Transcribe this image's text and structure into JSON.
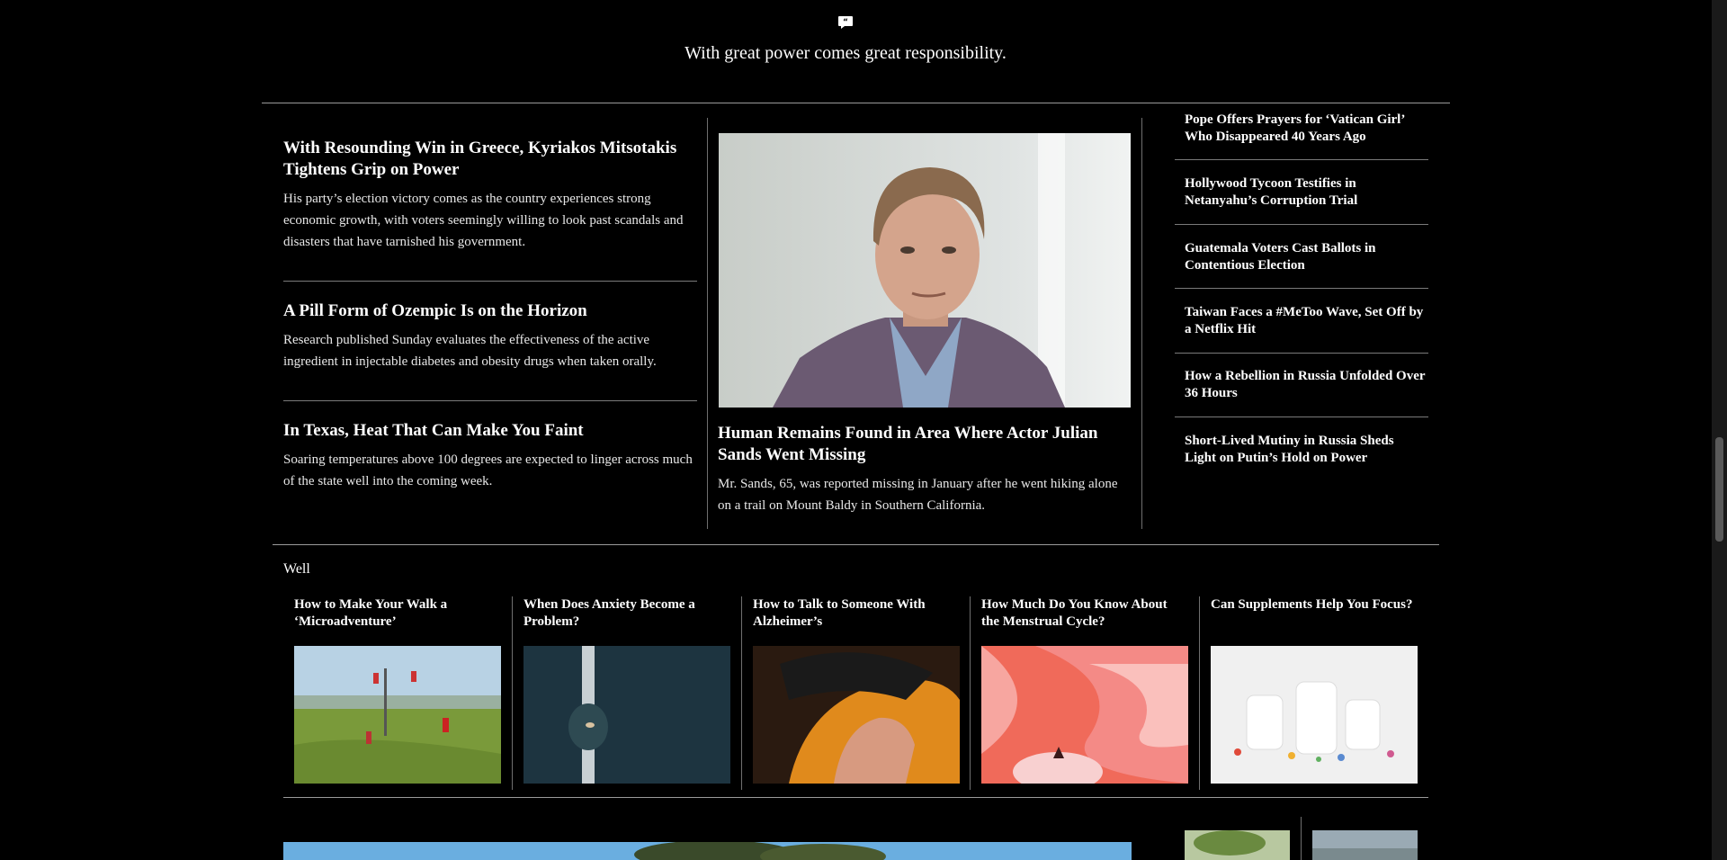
{
  "quote": {
    "icon": "quote-icon",
    "text": "With great power comes great responsibility."
  },
  "left_stories": [
    {
      "headline": "With Resounding Win in Greece, Kyriakos Mitsotakis Tightens Grip on Power",
      "summary": "His party’s election victory comes as the country experiences strong economic growth, with voters seemingly willing to look past scandals and disasters that have tarnished his government."
    },
    {
      "headline": "A Pill Form of Ozempic Is on the Horizon",
      "summary": "Research published Sunday evaluates the effectiveness of the active ingredient in injectable diabetes and obesity drugs when taken orally."
    },
    {
      "headline": "In Texas, Heat That Can Make You Faint",
      "summary": "Soaring temperatures above 100 degrees are expected to linger across much of the state well into the coming week."
    }
  ],
  "lead_story": {
    "headline": "Human Remains Found in Area Where Actor Julian Sands Went Missing",
    "summary": "Mr. Sands, 65, was reported missing in January after he went hiking alone on a trail on Mount Baldy in Southern California."
  },
  "right_headlines": [
    "Pope Offers Prayers for ‘Vatican Girl’ Who Disappeared 40 Years Ago",
    "Hollywood Tycoon Testifies in Netanyahu’s Corruption Trial",
    "Guatemala Voters Cast Ballots in Contentious Election",
    "Taiwan Faces a #MeToo Wave, Set Off by a Netflix Hit",
    "How a Rebellion in Russia Unfolded Over 36 Hours",
    "Short-Lived Mutiny in Russia Sheds Light on Putin’s Hold on Power"
  ],
  "well": {
    "label": "Well",
    "cards": [
      {
        "headline": "How to Make Your Walk a ‘Microadventure’"
      },
      {
        "headline": "When Does Anxiety Become a Problem?"
      },
      {
        "headline": "How to Talk to Someone With Alzheimer’s"
      },
      {
        "headline": "How Much Do You Know About the Menstrual Cycle?"
      },
      {
        "headline": "Can Supplements Help You Focus?"
      }
    ]
  },
  "colors": {
    "background": "#000000",
    "text": "#ffffff",
    "rule": "#9a9a9a"
  }
}
